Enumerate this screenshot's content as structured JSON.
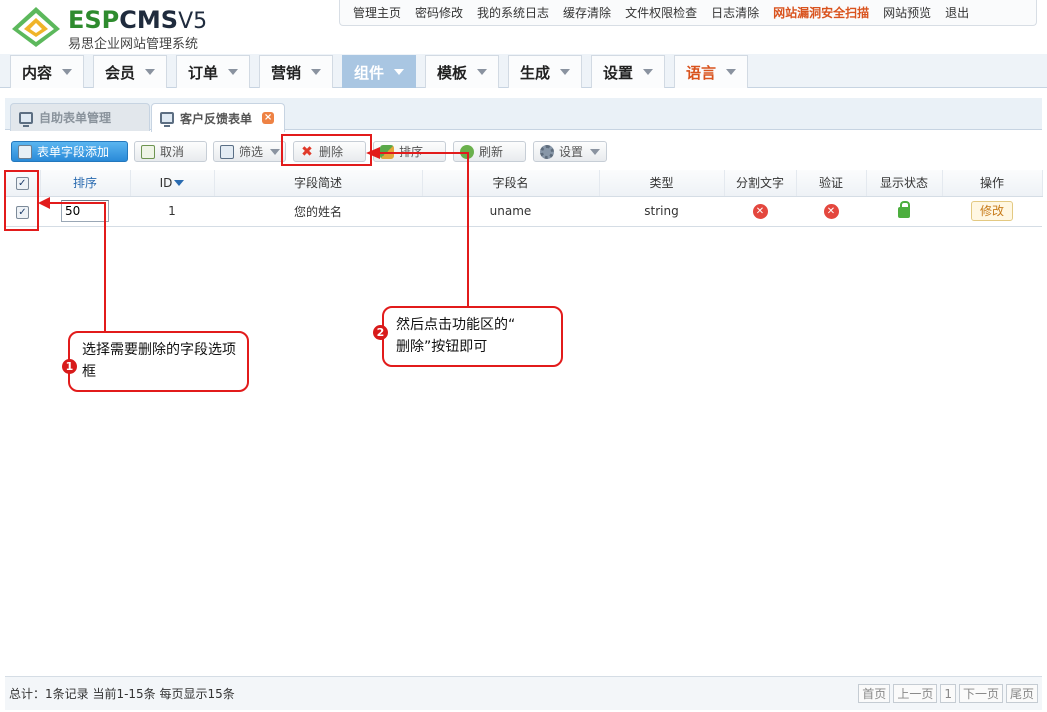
{
  "header": {
    "logo_esp": "ESP",
    "logo_cms": "CMS",
    "logo_v5": "V5",
    "logo_subtitle": "易思企业网站管理系统",
    "top_links": [
      "管理主页",
      "密码修改",
      "我的系统日志",
      "缓存清除",
      "文件权限检查",
      "日志清除",
      "网站漏洞安全扫描",
      "网站预览",
      "退出"
    ],
    "highlight_link_index": 6
  },
  "main_nav": {
    "tabs": [
      "内容",
      "会员",
      "订单",
      "营销",
      "组件",
      "模板",
      "生成",
      "设置",
      "语言"
    ],
    "active_index": 4,
    "red_index": 8
  },
  "sub_tabs": {
    "tab1": "自助表单管理",
    "tab2": "客户反馈表单"
  },
  "toolbar": {
    "add_label": "表单字段添加",
    "cancel_label": "取消",
    "filter_label": "筛选",
    "delete_label": "删除",
    "sort_label": "排序",
    "refresh_label": "刷新",
    "settings_label": "设置"
  },
  "table": {
    "headers": {
      "sort": "排序",
      "id": "ID",
      "desc": "字段简述",
      "name": "字段名",
      "type": "类型",
      "split": "分割文字",
      "validate": "验证",
      "status": "显示状态",
      "action": "操作"
    },
    "rows": [
      {
        "sort": "50",
        "id": "1",
        "desc": "您的姓名",
        "name": "uname",
        "type": "string",
        "edit": "修改"
      }
    ]
  },
  "footer": {
    "summary": "总计：1条记录 当前1-15条 每页显示15条",
    "first": "首页",
    "prev": "上一页",
    "page": "1",
    "next": "下一页",
    "last": "尾页"
  },
  "annotations": {
    "callout1": "选择需要删除的字段选项框",
    "callout1_num": "1",
    "callout2_line1": "然后点击功能区的“",
    "callout2_line2": "删除”按钮即可",
    "callout2_num": "2"
  },
  "colors": {
    "accent": "#a9c6e2",
    "annotation_red": "#e21b1b",
    "highlight_link": "#d9531e"
  }
}
